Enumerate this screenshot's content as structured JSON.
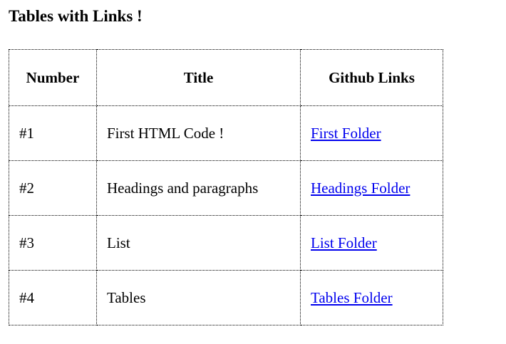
{
  "page": {
    "title": "Tables with Links !"
  },
  "table": {
    "headers": {
      "number": "Number",
      "title": "Title",
      "links": "Github Links"
    },
    "rows": [
      {
        "number": "#1",
        "title": "First HTML Code !",
        "link_text": "First Folder"
      },
      {
        "number": "#2",
        "title": "Headings and paragraphs",
        "link_text": "Headings Folder"
      },
      {
        "number": "#3",
        "title": "List",
        "link_text": "List Folder"
      },
      {
        "number": "#4",
        "title": "Tables",
        "link_text": "Tables Folder"
      }
    ]
  },
  "colors": {
    "link": "#0000ee",
    "border": "#000000",
    "text": "#000000",
    "background": "#ffffff"
  }
}
